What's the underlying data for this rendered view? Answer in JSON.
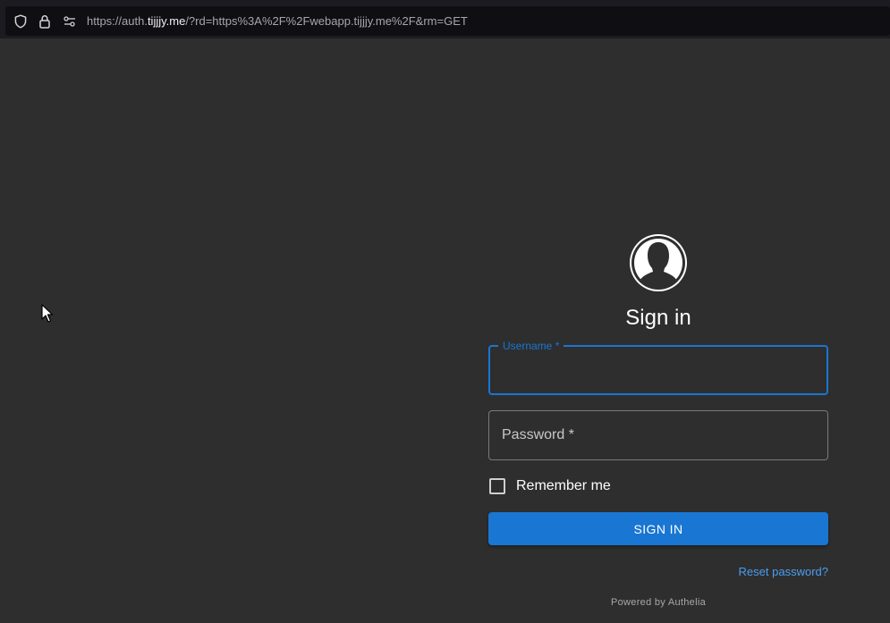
{
  "browser": {
    "url_prefix": "https://auth.",
    "url_domain": "tijjjy.me",
    "url_rest": "/?rd=https%3A%2F%2Fwebapp.tijjjy.me%2F&rm=GET",
    "icons": [
      "shield-icon",
      "lock-icon",
      "permissions-icon"
    ]
  },
  "login": {
    "title": "Sign in",
    "username": {
      "label": "Username *",
      "value": ""
    },
    "password": {
      "label": "Password *",
      "value": ""
    },
    "remember_label": "Remember me",
    "remember_checked": false,
    "submit_label": "SIGN IN",
    "reset_label": "Reset password?",
    "powered_by": "Powered by Authelia"
  },
  "colors": {
    "background": "#2e2e2e",
    "accent": "#1976d2",
    "link": "#4a9ef0",
    "urlbar": "#1c1b22"
  }
}
